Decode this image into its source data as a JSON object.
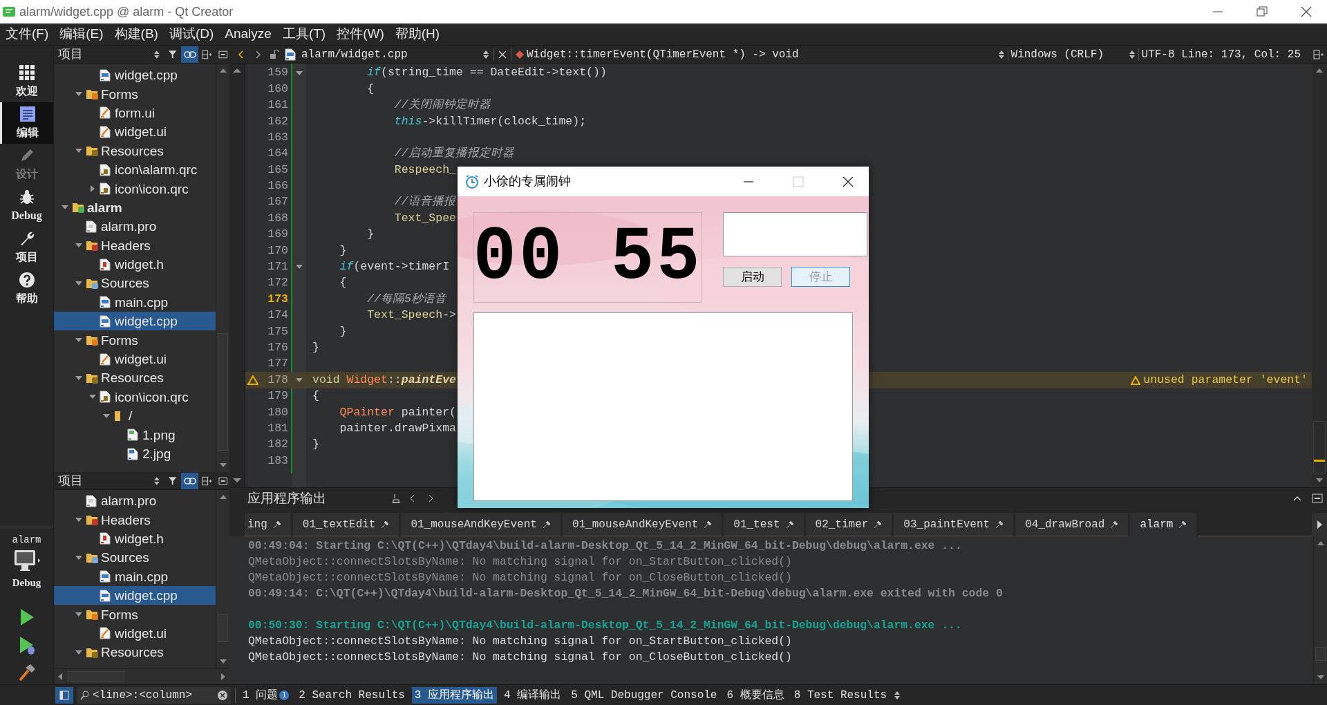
{
  "window": {
    "title": "alarm/widget.cpp @ alarm - Qt Creator"
  },
  "menu": [
    "文件(F)",
    "编辑(E)",
    "构建(B)",
    "调试(D)",
    "Analyze",
    "工具(T)",
    "控件(W)",
    "帮助(H)"
  ],
  "modes": [
    {
      "label": "欢迎",
      "kind": "grid",
      "selected": false,
      "disabled": false
    },
    {
      "label": "编辑",
      "kind": "edit",
      "selected": true,
      "disabled": false
    },
    {
      "label": "设计",
      "kind": "pen",
      "selected": false,
      "disabled": true
    },
    {
      "label": "Debug",
      "kind": "bug",
      "selected": false,
      "disabled": false
    },
    {
      "label": "项目",
      "kind": "wrench",
      "selected": false,
      "disabled": false
    },
    {
      "label": "帮助",
      "kind": "help",
      "selected": false,
      "disabled": false
    }
  ],
  "kit": {
    "project": "alarm",
    "build": "Debug"
  },
  "upper_panel": {
    "title": "项目",
    "tree": [
      {
        "children": [
          {
            "children": [
              {
                "label": "widget.cpp",
                "kind": "cpp",
                "selected": false
              }
            ]
          },
          {
            "label": "Forms",
            "kind": "forms",
            "expanded": true,
            "selected": false,
            "children": [
              {
                "label": "form.ui",
                "kind": "ui",
                "selected": false
              },
              {
                "label": "widget.ui",
                "kind": "ui",
                "selected": false
              }
            ]
          },
          {
            "label": "Resources",
            "kind": "resources",
            "expanded": true,
            "selected": false,
            "children": [
              {
                "label": "icon\\alarm.qrc",
                "kind": "qrc",
                "selected": false
              },
              {
                "label": "icon\\icon.qrc",
                "kind": "qrc",
                "expanded": false,
                "selected": false
              }
            ]
          }
        ]
      },
      {
        "label": "alarm",
        "kind": "project",
        "expanded": true,
        "selected": false,
        "children": [
          {
            "label": "alarm.pro",
            "kind": "pro",
            "selected": false
          },
          {
            "label": "Headers",
            "kind": "headers",
            "expanded": true,
            "selected": false,
            "children": [
              {
                "label": "widget.h",
                "kind": "h",
                "selected": false
              }
            ]
          },
          {
            "label": "Sources",
            "kind": "sources",
            "expanded": true,
            "selected": false,
            "children": [
              {
                "label": "main.cpp",
                "kind": "cpp",
                "selected": false
              },
              {
                "label": "widget.cpp",
                "kind": "cpp",
                "selected": true
              }
            ]
          },
          {
            "label": "Forms",
            "kind": "forms",
            "expanded": true,
            "selected": false,
            "children": [
              {
                "label": "widget.ui",
                "kind": "ui",
                "selected": false
              }
            ]
          },
          {
            "label": "Resources",
            "kind": "resources",
            "expanded": true,
            "selected": false,
            "children": [
              {
                "label": "icon\\icon.qrc",
                "kind": "qrc",
                "expanded": true,
                "selected": false,
                "children": [
                  {
                    "label": "/",
                    "kind": "folder",
                    "expanded": true,
                    "selected": false,
                    "children": [
                      {
                        "label": "1.png",
                        "kind": "png",
                        "selected": false
                      },
                      {
                        "label": "2.jpg",
                        "kind": "jpg",
                        "selected": false
                      }
                    ]
                  }
                ]
              }
            ]
          }
        ]
      }
    ]
  },
  "lower_panel": {
    "title": "项目",
    "tree": [
      {
        "children": [
          {
            "label": "alarm.pro",
            "kind": "pro",
            "selected": false
          },
          {
            "label": "Headers",
            "kind": "headers",
            "expanded": true,
            "selected": false,
            "children": [
              {
                "label": "widget.h",
                "kind": "h",
                "selected": false
              }
            ]
          },
          {
            "label": "Sources",
            "kind": "sources",
            "expanded": true,
            "selected": false,
            "children": [
              {
                "label": "main.cpp",
                "kind": "cpp",
                "selected": false
              },
              {
                "label": "widget.cpp",
                "kind": "cpp",
                "selected": true
              }
            ]
          },
          {
            "label": "Forms",
            "kind": "forms",
            "expanded": true,
            "selected": false,
            "children": [
              {
                "label": "widget.ui",
                "kind": "ui",
                "selected": false
              }
            ]
          },
          {
            "label": "Resources",
            "kind": "resources",
            "expanded": true,
            "selected": false
          }
        ]
      }
    ]
  },
  "editor": {
    "file": "alarm/widget.cpp",
    "symbol": "Widget::timerEvent(QTimerEvent *) -> void",
    "line_ending": "Windows (CRLF)",
    "position": "UTF-8 Line: 173, Col: 25",
    "lines": [
      {
        "number": "159",
        "fold": true,
        "segments": [
          {
            "kind": "kw",
            "text": "        if"
          },
          {
            "kind": "tx",
            "text": "(string_time == DateEdit->text())"
          }
        ]
      },
      {
        "number": "160",
        "segments": [
          {
            "kind": "tx",
            "text": "        {"
          }
        ]
      },
      {
        "number": "161",
        "segments": [
          {
            "kind": "cm",
            "text": "            //关闭闹钟定时器"
          }
        ]
      },
      {
        "number": "162",
        "segments": [
          {
            "kind": "kw",
            "text": "            this"
          },
          {
            "kind": "tx",
            "text": "->killTimer(clock_time);"
          }
        ]
      },
      {
        "number": "163"
      },
      {
        "number": "164",
        "segments": [
          {
            "kind": "cm",
            "text": "            //启动重复播报定时器"
          }
        ]
      },
      {
        "number": "165",
        "segments": [
          {
            "kind": "mb",
            "text": "            Respeech_"
          }
        ]
      },
      {
        "number": "166"
      },
      {
        "number": "167",
        "segments": [
          {
            "kind": "cm",
            "text": "            //语音播报"
          }
        ]
      },
      {
        "number": "168",
        "segments": [
          {
            "kind": "mb",
            "text": "            Text_Spee"
          }
        ]
      },
      {
        "number": "169",
        "segments": [
          {
            "kind": "tx",
            "text": "        }"
          }
        ]
      },
      {
        "number": "170",
        "segments": [
          {
            "kind": "tx",
            "text": "    }"
          }
        ]
      },
      {
        "number": "171",
        "fold": true,
        "segments": [
          {
            "kind": "kw",
            "text": "    if"
          },
          {
            "kind": "tx",
            "text": "(event->timerI"
          }
        ]
      },
      {
        "number": "172",
        "segments": [
          {
            "kind": "tx",
            "text": "    {"
          }
        ]
      },
      {
        "number": "173",
        "current": true,
        "segments": [
          {
            "kind": "cm",
            "text": "        //每隔5秒语音"
          }
        ]
      },
      {
        "number": "174",
        "segments": [
          {
            "kind": "mb",
            "text": "        Text_Speech"
          },
          {
            "kind": "tx",
            "text": "->"
          }
        ]
      },
      {
        "number": "175",
        "segments": [
          {
            "kind": "tx",
            "text": "    }"
          }
        ]
      },
      {
        "number": "176",
        "segments": [
          {
            "kind": "tx",
            "text": "}"
          }
        ]
      },
      {
        "number": "177"
      },
      {
        "number": "178",
        "fold": true,
        "warning": true,
        "annotation": "unused parameter 'event'",
        "segments": [
          {
            "kind": "mb",
            "text": "void "
          },
          {
            "kind": "ty",
            "text": "Widget"
          },
          {
            "kind": "tx",
            "text": "::"
          },
          {
            "kind": "fn",
            "text": "paintEve"
          }
        ]
      },
      {
        "number": "179",
        "segments": [
          {
            "kind": "tx",
            "text": "{"
          }
        ]
      },
      {
        "number": "180",
        "segments": [
          {
            "kind": "ty",
            "text": "    QPainter"
          },
          {
            "kind": "tx",
            "text": " painter("
          }
        ]
      },
      {
        "number": "181",
        "segments": [
          {
            "kind": "tx",
            "text": "    painter.drawPixma"
          }
        ]
      },
      {
        "number": "182",
        "segments": [
          {
            "kind": "tx",
            "text": "}"
          }
        ]
      },
      {
        "number": "183"
      }
    ]
  },
  "output": {
    "title": "应用程序输出",
    "tabs": [
      {
        "label": "ing",
        "selected": false
      },
      {
        "label": "01_textEdit",
        "selected": false
      },
      {
        "label": "01_mouseAndKeyEvent",
        "selected": false
      },
      {
        "label": "01_mouseAndKeyEvent",
        "selected": false
      },
      {
        "label": "01_test",
        "selected": false
      },
      {
        "label": "02_timer",
        "selected": false
      },
      {
        "label": "03_paintEvent",
        "selected": false
      },
      {
        "label": "04_drawBroad",
        "selected": false
      },
      {
        "label": "alarm",
        "selected": true
      }
    ],
    "runs": [
      {
        "lines": [
          {
            "kind": "old_info",
            "text": "00:49:04: Starting C:\\QT(C++)\\QTday4\\build-alarm-Desktop_Qt_5_14_2_MinGW_64_bit-Debug\\debug\\alarm.exe ..."
          },
          {
            "kind": "old_msg",
            "text": "QMetaObject::connectSlotsByName: No matching signal for on_StartButton_clicked()"
          },
          {
            "kind": "old_msg",
            "text": "QMetaObject::connectSlotsByName: No matching signal for on_CloseButton_clicked()"
          },
          {
            "kind": "old_info",
            "text": "00:49:14: C:\\QT(C++)\\QTday4\\build-alarm-Desktop_Qt_5_14_2_MinGW_64_bit-Debug\\debug\\alarm.exe exited with code 0"
          }
        ]
      },
      {
        "lines": [
          {
            "kind": "info",
            "text": "00:50:30: Starting C:\\QT(C++)\\QTday4\\build-alarm-Desktop_Qt_5_14_2_MinGW_64_bit-Debug\\debug\\alarm.exe ..."
          },
          {
            "kind": "msg",
            "text": "QMetaObject::connectSlotsByName: No matching signal for on_StartButton_clicked()"
          },
          {
            "kind": "msg",
            "text": "QMetaObject::connectSlotsByName: No matching signal for on_CloseButton_clicked()"
          }
        ]
      }
    ]
  },
  "status_bar": {
    "locator_placeholder": "<line>:<column>",
    "panes": [
      {
        "label": "1 问题",
        "badge": "1",
        "selected": false
      },
      {
        "label": "2 Search Results",
        "selected": false
      },
      {
        "label": "3 应用程序输出",
        "selected": true
      },
      {
        "label": "4 编译输出",
        "selected": false
      },
      {
        "label": "5 QML Debugger Console",
        "selected": false
      },
      {
        "label": "6 概要信息",
        "selected": false
      },
      {
        "label": "8 Test Results",
        "selected": false
      }
    ]
  },
  "dialog": {
    "title": "小徐的专属闹钟",
    "display": "00 55",
    "buttons": [
      {
        "label": "启动",
        "focused": false
      },
      {
        "label": "停止",
        "focused": true
      }
    ]
  }
}
